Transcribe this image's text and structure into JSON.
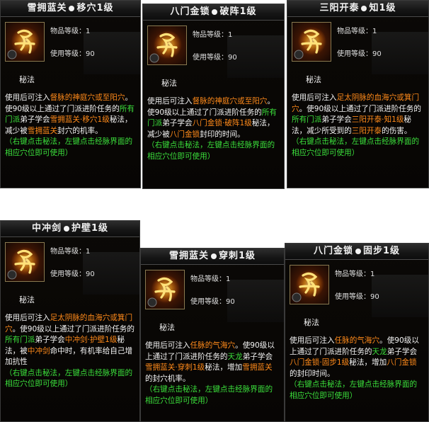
{
  "labels": {
    "item_level": "物品等级：",
    "use_level": "使用等级：",
    "section": "秘法"
  },
  "colors": {
    "orange_highlight": "#ff8a1a",
    "green_text": "#3be03b",
    "background": "#050403"
  },
  "tooltips": [
    {
      "name": "雪拥蓝关",
      "skill": "移穴1级",
      "icon": "rune-icon",
      "item_level": "1",
      "use_level": "90",
      "desc": [
        {
          "t": "使用后可注入",
          "c": "w"
        },
        {
          "t": "督脉的神庭穴或至阳穴",
          "c": "o"
        },
        {
          "t": "。使90级以上通过了门派进阶任务的",
          "c": "w"
        },
        {
          "t": "所有门派",
          "c": "g"
        },
        {
          "t": "弟子学会",
          "c": "w"
        },
        {
          "t": "雪拥蓝关·移穴1级",
          "c": "o"
        },
        {
          "t": "秘法，减少被",
          "c": "w"
        },
        {
          "t": "雪拥蓝关",
          "c": "o"
        },
        {
          "t": "封穴的机率。",
          "c": "w"
        }
      ],
      "hint": "（右键点击秘法，左键点击经脉界面的相应穴位即可使用）"
    },
    {
      "name": "八门金锁",
      "skill": "破阵1级",
      "icon": "rune-icon",
      "item_level": "1",
      "use_level": "90",
      "desc": [
        {
          "t": "使用后可注入",
          "c": "w"
        },
        {
          "t": "督脉的神庭穴或至阳穴",
          "c": "o"
        },
        {
          "t": "。使90级以上通过了门派进阶任务的",
          "c": "w"
        },
        {
          "t": "所有门派",
          "c": "g"
        },
        {
          "t": "弟子学会",
          "c": "w"
        },
        {
          "t": "八门金锁·破阵1级",
          "c": "o"
        },
        {
          "t": "秘法，减少被",
          "c": "w"
        },
        {
          "t": "八门金锁",
          "c": "o"
        },
        {
          "t": "封印的时间。",
          "c": "w"
        }
      ],
      "hint": "（右键点击秘法，左键点击经脉界面的相应穴位即可使用）"
    },
    {
      "name": "三阳开泰",
      "skill": "知1级",
      "icon": "rune-icon",
      "item_level": "1",
      "use_level": "90",
      "desc": [
        {
          "t": "使用后可注入",
          "c": "w"
        },
        {
          "t": "足太阴脉的血海穴或箕门穴",
          "c": "o"
        },
        {
          "t": "。使90级以上通过了门派进阶任务的",
          "c": "w"
        },
        {
          "t": "所有门派",
          "c": "g"
        },
        {
          "t": "弟子学会",
          "c": "w"
        },
        {
          "t": "三阳开泰·知1级",
          "c": "o"
        },
        {
          "t": "秘法，减少所受到的",
          "c": "w"
        },
        {
          "t": "三阳开泰",
          "c": "o"
        },
        {
          "t": "的伤害。",
          "c": "w"
        }
      ],
      "hint": "（右键点击秘法，左键点击经脉界面的相应穴位即可使用）"
    },
    {
      "name": "中冲剑",
      "skill": "护壁1级",
      "icon": "rune-icon",
      "item_level": "1",
      "use_level": "90",
      "desc": [
        {
          "t": "使用后可注入",
          "c": "w"
        },
        {
          "t": "足太阴脉的血海穴或箕门穴",
          "c": "o"
        },
        {
          "t": "。使90级以上通过了门派进阶任务的",
          "c": "w"
        },
        {
          "t": "所有门派",
          "c": "g"
        },
        {
          "t": "弟子学会",
          "c": "w"
        },
        {
          "t": "中冲剑·护壁1级",
          "c": "o"
        },
        {
          "t": "秘法，被",
          "c": "w"
        },
        {
          "t": "中冲剑",
          "c": "o"
        },
        {
          "t": "命中时，有机率给自己增加抗性",
          "c": "w"
        }
      ],
      "hint": "（右键点击秘法，左键点击经脉界面的相应穴位即可使用）"
    },
    {
      "name": "雪拥蓝关",
      "skill": "穿刺1级",
      "icon": "rune-icon",
      "item_level": "1",
      "use_level": "90",
      "desc": [
        {
          "t": "使用后可注入",
          "c": "w"
        },
        {
          "t": "任脉的气海穴",
          "c": "o"
        },
        {
          "t": "。使90级以上通过了门派进阶任务的",
          "c": "w"
        },
        {
          "t": "天龙",
          "c": "g"
        },
        {
          "t": "弟子学会",
          "c": "w"
        },
        {
          "t": "雪拥蓝关·穿刺1级",
          "c": "o"
        },
        {
          "t": "秘法，增加",
          "c": "w"
        },
        {
          "t": "雪拥蓝关",
          "c": "o"
        },
        {
          "t": "的封穴机率。",
          "c": "w"
        }
      ],
      "hint": "（右键点击秘法，左键点击经脉界面的相应穴位即可使用）"
    },
    {
      "name": "八门金锁",
      "skill": "固步1级",
      "icon": "rune-icon",
      "item_level": "1",
      "use_level": "90",
      "desc": [
        {
          "t": "使用后可注入",
          "c": "w"
        },
        {
          "t": "任脉的气海穴",
          "c": "o"
        },
        {
          "t": "。使90级以上通过了门派进阶任务的",
          "c": "w"
        },
        {
          "t": "天龙",
          "c": "g"
        },
        {
          "t": "弟子学会",
          "c": "w"
        },
        {
          "t": "八门金锁·固步1级",
          "c": "o"
        },
        {
          "t": "秘法，增加",
          "c": "w"
        },
        {
          "t": "八门金锁",
          "c": "o"
        },
        {
          "t": "的封印时间。",
          "c": "w"
        }
      ],
      "hint": "（右键点击秘法，左键点击经脉界面的相应穴位即可使用）"
    }
  ]
}
